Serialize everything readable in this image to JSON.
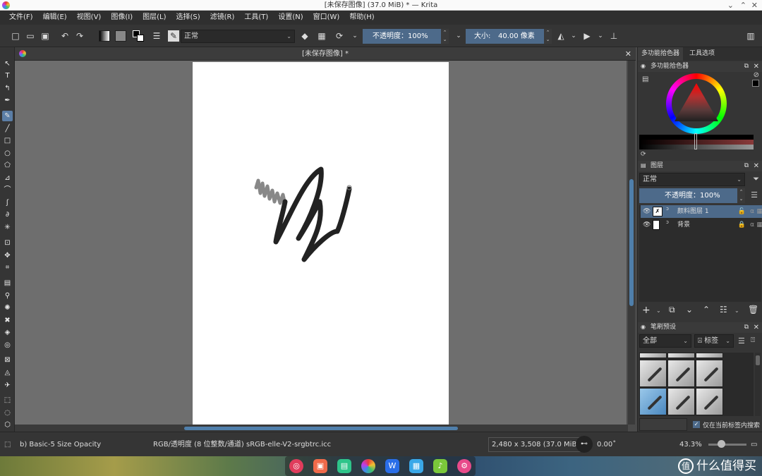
{
  "window": {
    "title": "[未保存图像] (37.0 MiB) * — Krita",
    "controls": {
      "minimize": "⌄",
      "maximize": "⌃",
      "close": "✕"
    }
  },
  "menu": [
    "文件(F)",
    "编辑(E)",
    "视图(V)",
    "图像(I)",
    "图层(L)",
    "选择(S)",
    "滤镜(R)",
    "工具(T)",
    "设置(N)",
    "窗口(W)",
    "帮助(H)"
  ],
  "toolbar": {
    "blend_mode": "正常",
    "opacity_label": "不透明度：100%",
    "size_label": "大小:",
    "size_value": "40.00 像素"
  },
  "document": {
    "tab_title": "[未保存图像]  *",
    "close": "✕"
  },
  "dock": {
    "tabs": [
      "多功能拾色器",
      "工具选项"
    ],
    "color_selector_title": "多功能拾色器",
    "layers_title": "图层",
    "layers_blend_mode": "正常",
    "layers_opacity": "不透明度：100%",
    "layers": [
      {
        "name": "颜料图层 1",
        "selected": true
      },
      {
        "name": "背景",
        "selected": false
      }
    ],
    "brush_presets_title": "笔刷预设",
    "preset_filter": "全部",
    "preset_tag": "标签",
    "only_current_tag": "仅在当前标签内搜索"
  },
  "status": {
    "brush": "b) Basic-5 Size Opacity",
    "color_profile": "RGB/透明度 (8 位整数/通道)  sRGB-elle-V2-srgbtrc.icc",
    "image_size": "2,480 x 3,508 (37.0 MiB)",
    "rotation": "0.00˚",
    "zoom": "43.3%"
  },
  "taskbar": {
    "brand": "什么值得买",
    "brand_logo": "值"
  },
  "colors": {
    "accent": "#4d6a8a",
    "panel": "#353535",
    "canvas_bg": "#6e6e6e"
  }
}
